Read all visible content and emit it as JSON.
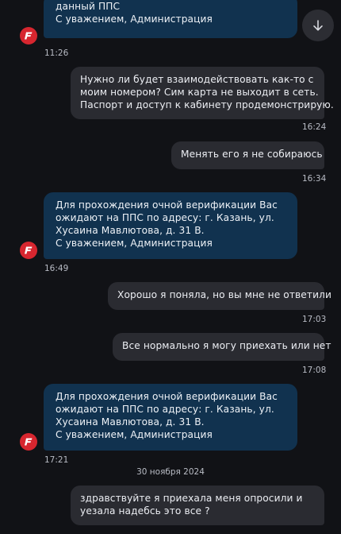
{
  "messages": [
    {
      "direction": "in",
      "lines": [
        "данный ППС",
        "С уважением, Администрация"
      ],
      "time": "11:26",
      "avatar_icon": "f-logo-icon"
    },
    {
      "direction": "out",
      "lines": [
        "Нужно ли будет взаимодействовать как-то с",
        "моим номером? Сим карта не выходит в сеть.",
        "Паспорт и доступ к кабинету продемонстрирую."
      ],
      "time": "16:24"
    },
    {
      "direction": "out",
      "lines": [
        "Менять его я не собираюсь"
      ],
      "time": "16:34"
    },
    {
      "direction": "in",
      "lines": [
        "Для прохождения очной верификации Вас",
        "ожидают на ППС по адресу: г. Казань, ул.",
        "Хусаина Мавлютова, д. 31 В.",
        "С уважением, Администрация"
      ],
      "time": "16:49",
      "avatar_icon": "f-logo-icon"
    },
    {
      "direction": "out",
      "lines": [
        "Хорошо я поняла, но вы мне не ответили"
      ],
      "time": "17:03"
    },
    {
      "direction": "out",
      "lines": [
        "Все нормально я могу приехать или нет"
      ],
      "time": "17:08"
    },
    {
      "direction": "in",
      "lines": [
        "Для прохождения очной верификации Вас",
        "ожидают на ППС по адресу: г. Казань, ул.",
        "Хусаина Мавлютова, д. 31 В.",
        "С уважением, Администрация"
      ],
      "time": "17:21",
      "avatar_icon": "f-logo-icon"
    },
    {
      "direction": "out",
      "lines": [
        "здравствуйте я приехала меня опросили и",
        "уезала надебсь это все ?"
      ],
      "time": ""
    }
  ],
  "date_separator": "30 ноября 2024",
  "scroll_button_icon": "arrow-down-icon",
  "colors": {
    "background": "#111216",
    "incoming_bubble": "#11324f",
    "outgoing_bubble": "#2a2b31",
    "avatar": "#d7262f",
    "timestamp": "#b9bcc5"
  }
}
